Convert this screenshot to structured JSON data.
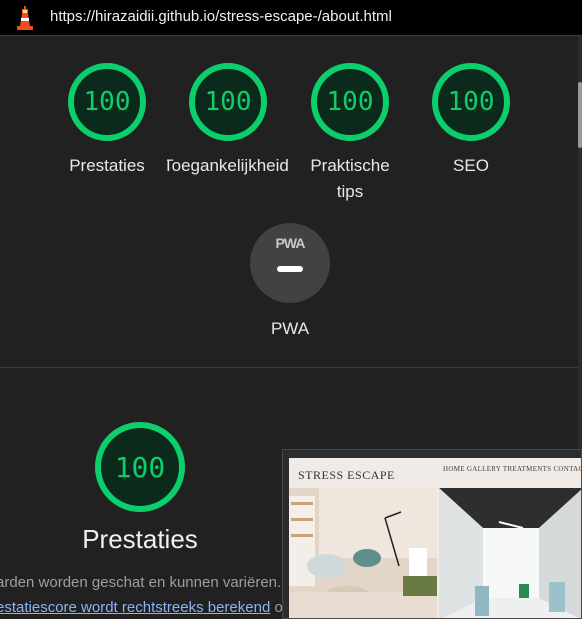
{
  "browser": {
    "url": "https://hirazaidii.github.io/stress-escape-/about.html"
  },
  "summary": {
    "gauges": [
      {
        "score": "100",
        "label": "Prestaties"
      },
      {
        "score": "100",
        "label": "Toegankelijkheid"
      },
      {
        "score": "100",
        "label": "Praktische tips"
      },
      {
        "score": "100",
        "label": "SEO"
      }
    ],
    "pwa": {
      "badge": "PWA",
      "label": "PWA"
    }
  },
  "performance": {
    "score": "100",
    "title": "Prestaties",
    "desc_line1": "arden worden geschat en kunnen variëren. H",
    "desc_link": "estatiescore wordt rechtstreeks berekend",
    "desc_after": " o"
  },
  "screenshot": {
    "logo": "STRESS ESCAPE",
    "nav": "HOME  GALLERY  TREATMENTS  CONTACT"
  },
  "colors": {
    "pass": "#0cce6b",
    "pass_track": "#0cce6b",
    "background": "#212121",
    "link": "#8ab4f8"
  }
}
